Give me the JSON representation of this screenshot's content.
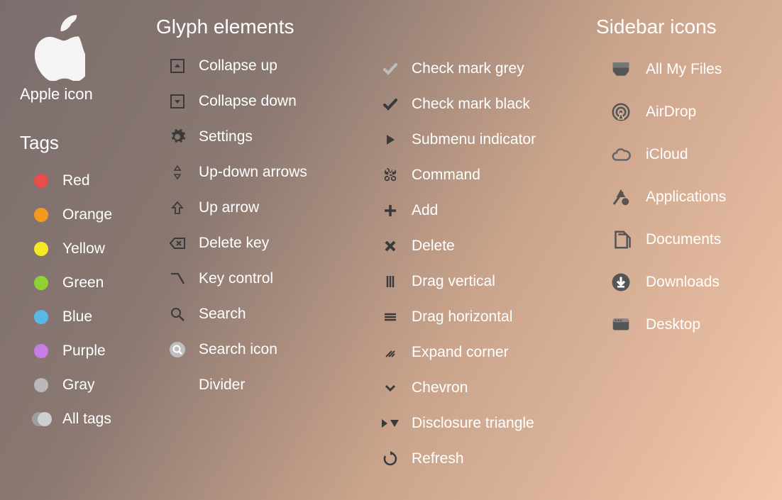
{
  "apple": {
    "label": "Apple icon"
  },
  "tags": {
    "header": "Tags",
    "items": [
      {
        "label": "Red",
        "color": "#e84c4c"
      },
      {
        "label": "Orange",
        "color": "#f39a1f"
      },
      {
        "label": "Yellow",
        "color": "#f4e924"
      },
      {
        "label": "Green",
        "color": "#8fd233"
      },
      {
        "label": "Blue",
        "color": "#5bb6ea"
      },
      {
        "label": "Purple",
        "color": "#c77de8"
      },
      {
        "label": "Gray",
        "color": "#b9b9b9"
      },
      {
        "label": "All tags",
        "color": "#cfcfcf"
      }
    ]
  },
  "glyphs": {
    "header": "Glyph elements",
    "col_a": [
      {
        "id": "collapse-up",
        "label": "Collapse up"
      },
      {
        "id": "collapse-down",
        "label": "Collapse down"
      },
      {
        "id": "settings",
        "label": "Settings"
      },
      {
        "id": "up-down-arrows",
        "label": "Up-down arrows"
      },
      {
        "id": "up-arrow",
        "label": "Up arrow"
      },
      {
        "id": "delete-key",
        "label": "Delete key"
      },
      {
        "id": "key-control",
        "label": "Key control"
      },
      {
        "id": "search",
        "label": "Search"
      },
      {
        "id": "search-icon",
        "label": "Search icon"
      },
      {
        "id": "divider",
        "label": "Divider"
      }
    ],
    "col_b": [
      {
        "id": "check-grey",
        "label": "Check mark grey"
      },
      {
        "id": "check-black",
        "label": "Check mark black"
      },
      {
        "id": "submenu",
        "label": "Submenu indicator"
      },
      {
        "id": "command",
        "label": "Command"
      },
      {
        "id": "add",
        "label": "Add"
      },
      {
        "id": "delete",
        "label": "Delete"
      },
      {
        "id": "drag-v",
        "label": "Drag vertical"
      },
      {
        "id": "drag-h",
        "label": "Drag horizontal"
      },
      {
        "id": "expand",
        "label": "Expand corner"
      },
      {
        "id": "chevron",
        "label": "Chevron"
      },
      {
        "id": "disclosure",
        "label": "Disclosure triangle"
      },
      {
        "id": "refresh",
        "label": "Refresh"
      }
    ]
  },
  "sidebar": {
    "header": "Sidebar icons",
    "items": [
      {
        "id": "all-my-files",
        "label": "All My Files"
      },
      {
        "id": "airdrop",
        "label": "AirDrop"
      },
      {
        "id": "icloud",
        "label": "iCloud"
      },
      {
        "id": "applications",
        "label": "Applications"
      },
      {
        "id": "documents",
        "label": "Documents"
      },
      {
        "id": "downloads",
        "label": "Downloads"
      },
      {
        "id": "desktop",
        "label": "Desktop"
      }
    ]
  }
}
